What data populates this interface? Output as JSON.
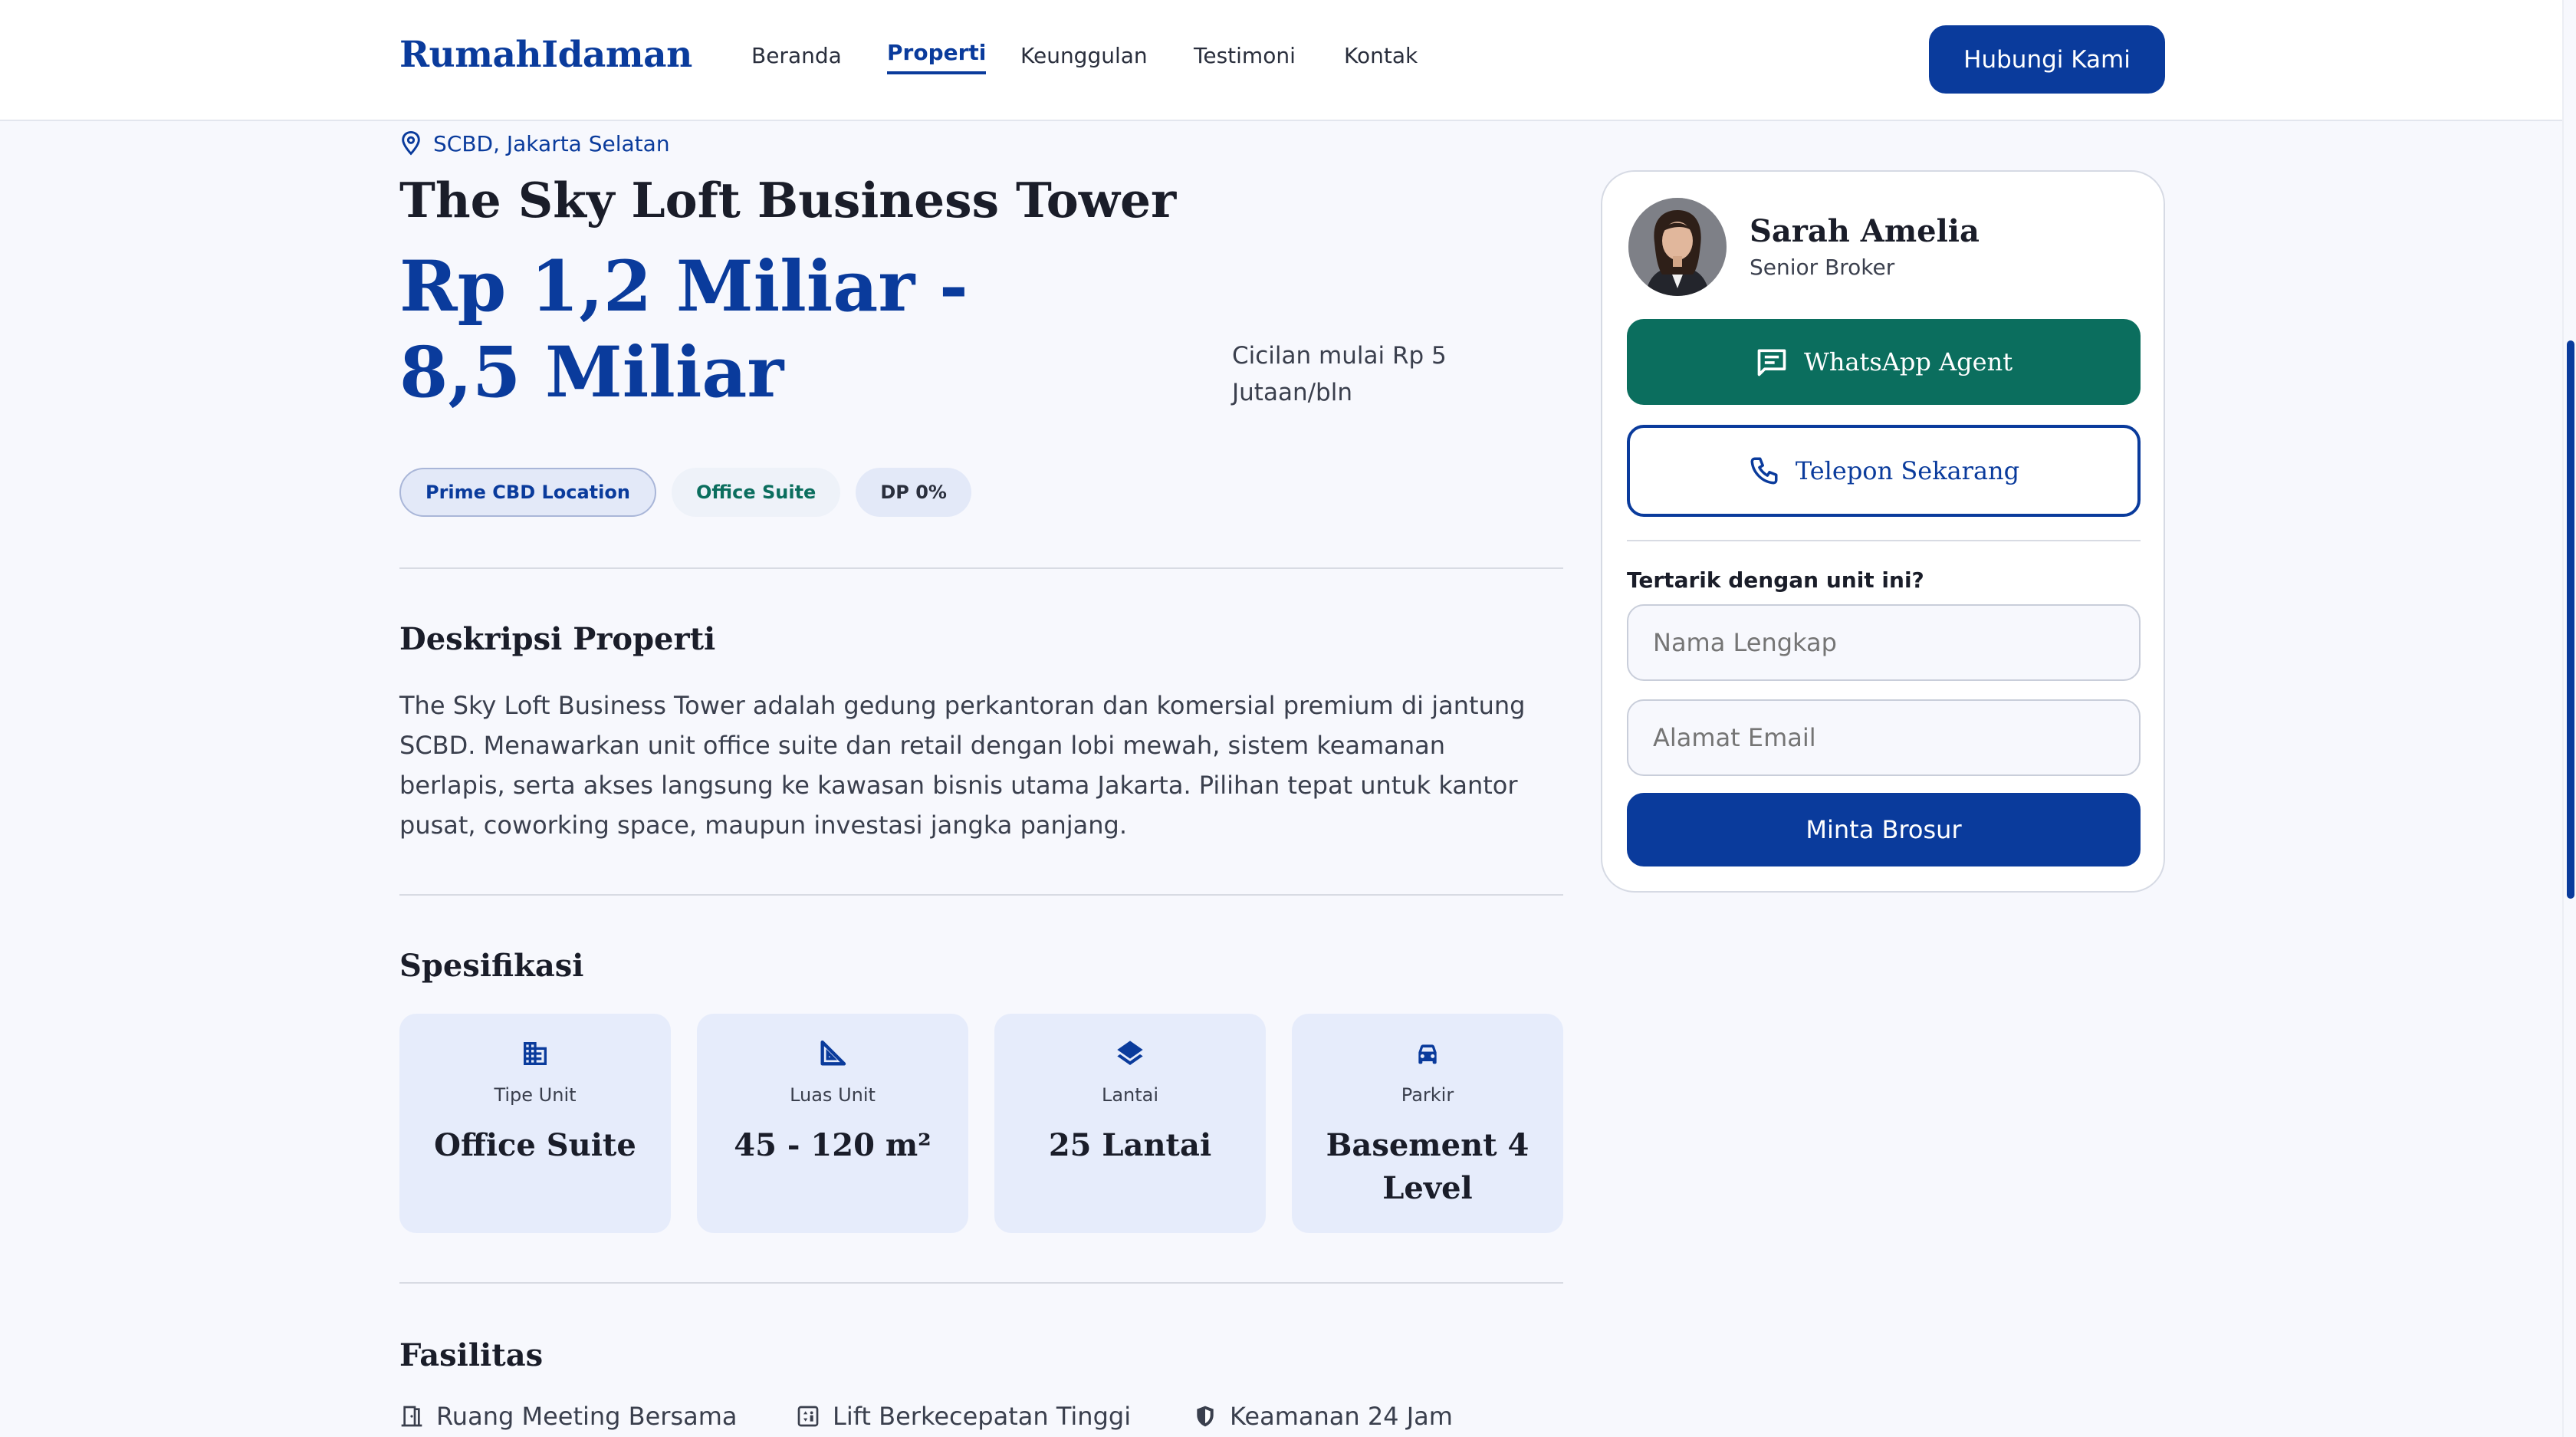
{
  "header": {
    "logo": "RumahIdaman",
    "nav": [
      "Beranda",
      "Properti",
      "Keunggulan",
      "Testimoni",
      "Kontak"
    ],
    "active_nav": "Properti",
    "cta": "Hubungi Kami"
  },
  "property": {
    "location": "SCBD, Jakarta Selatan",
    "title": "The Sky Loft Business Tower",
    "price": "Rp 1,2 Miliar - 8,5 Miliar",
    "installment": "Cicilan mulai Rp 5 Jutaan/bln",
    "tags": [
      "Prime CBD Location",
      "Office Suite",
      "DP 0%"
    ]
  },
  "description": {
    "heading": "Deskripsi Properti",
    "text": "The Sky Loft Business Tower adalah gedung perkantoran dan komersial premium di jantung SCBD. Menawarkan unit office suite dan retail dengan lobi mewah, sistem keamanan berlapis, serta akses langsung ke kawasan bisnis utama Jakarta. Pilihan tepat untuk kantor pusat, coworking space, maupun investasi jangka panjang."
  },
  "specs": {
    "heading": "Spesifikasi",
    "items": [
      {
        "label": "Tipe Unit",
        "value": "Office Suite",
        "icon": "building-icon"
      },
      {
        "label": "Luas Unit",
        "value": "45 - 120 m²",
        "icon": "set-square-icon"
      },
      {
        "label": "Lantai",
        "value": "25 Lantai",
        "icon": "layers-icon"
      },
      {
        "label": "Parkir",
        "value": "Basement 4 Level",
        "icon": "car-icon"
      }
    ]
  },
  "facilities": {
    "heading": "Fasilitas",
    "items": [
      {
        "label": "Ruang Meeting Bersama",
        "icon": "meeting-room-icon"
      },
      {
        "label": "Lift Berkecepatan Tinggi",
        "icon": "elevator-icon"
      },
      {
        "label": "Keamanan 24 Jam",
        "icon": "shield-icon"
      }
    ]
  },
  "agent": {
    "name": "Sarah Amelia",
    "role": "Senior Broker",
    "whatsapp_label": "WhatsApp Agent",
    "phone_label": "Telepon Sekarang",
    "form_title": "Tertarik dengan unit ini?",
    "name_placeholder": "Nama Lengkap",
    "email_placeholder": "Alamat Email",
    "submit_label": "Minta Brosur"
  },
  "colors": {
    "primary": "#0a3b9c",
    "whatsapp": "#0b6e5e",
    "background": "#f7f8fd",
    "spec_card": "#e6ecfb"
  }
}
